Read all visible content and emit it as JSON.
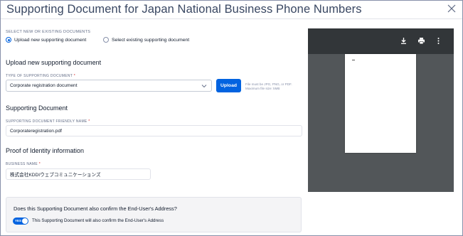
{
  "modal": {
    "title": "Supporting Document for Japan National Business Phone Numbers"
  },
  "choice": {
    "overline": "SELECT NEW OR EXISTING DOCUMENTS",
    "options": [
      {
        "label": "Upload new supporting document",
        "selected": true
      },
      {
        "label": "Select existing supporting document",
        "selected": false
      }
    ]
  },
  "upload": {
    "heading": "Upload new supporting document",
    "type_label": "TYPE OF SUPPORTING DOCUMENT",
    "required_mark": "*",
    "type_value": "Corporate registration document",
    "button_label": "Upload",
    "help_text": "File must be JPG, PNG, or PDF. Maximum file size: 5MB"
  },
  "supporting": {
    "heading": "Supporting Document",
    "friendly_name_label": "SUPPORTING DOCUMENT FRIENDLY NAME",
    "required_mark": "*",
    "friendly_name_value": "Corporateregistration.pdf"
  },
  "identity": {
    "heading": "Proof of Identity information",
    "business_name_label": "BUSINESS NAME",
    "required_mark": "*",
    "business_name_value": "株式会社KDDIウェブコミュニケーションズ"
  },
  "address": {
    "question": "Does this Supporting Document also confirm the End-User's Address?",
    "toggle_text": "YES",
    "toggle_on": true,
    "toggle_label": "This Supporting Document will also confirm the End-User's Address"
  },
  "viewer": {
    "icons": [
      "download-icon",
      "print-icon",
      "more-vertical-icon"
    ]
  },
  "colors": {
    "accent": "#0263e0",
    "viewer_bg": "#525659",
    "viewer_bar": "#323639"
  }
}
